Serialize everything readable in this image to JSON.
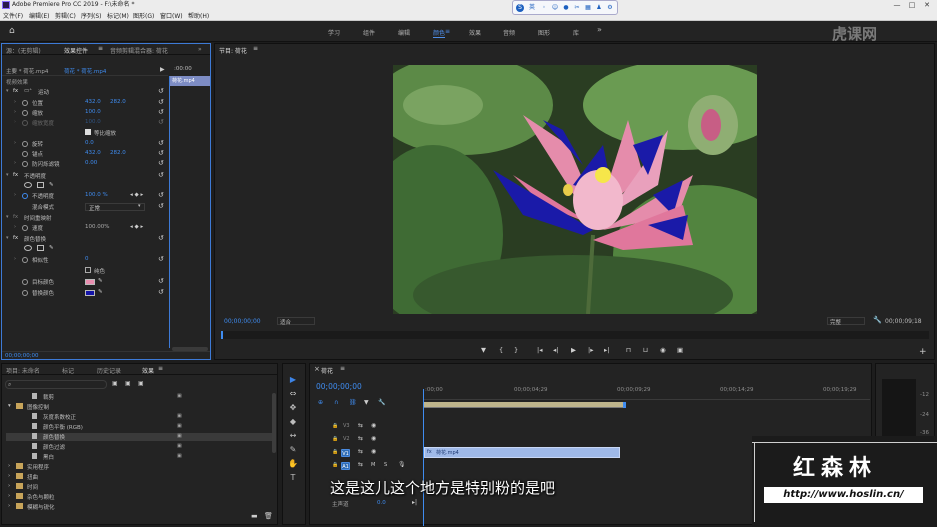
{
  "window": {
    "title": "Adobe Premiere Pro CC 2019 - F:\\未命名 *",
    "controls": [
      "—",
      "□",
      "✕"
    ]
  },
  "menu": [
    "文件(F)",
    "编辑(E)",
    "剪辑(C)",
    "序列(S)",
    "标记(M)",
    "图形(G)",
    "窗口(W)",
    "帮助(H)"
  ],
  "floatbar": {
    "label": "英"
  },
  "workspaces": {
    "items": [
      "学习",
      "组件",
      "编辑",
      "颜色",
      "效果",
      "音频",
      "图形",
      "库"
    ],
    "active": "颜色",
    "more": "»"
  },
  "watermark_top": "虎课网",
  "effect_controls": {
    "tabs": [
      "源：(无剪辑)",
      "效果控件",
      "音频剪辑混合器: 荷花"
    ],
    "path_master": "主要 * 荷花.mp4",
    "path_seq": "荷花 * 荷花.mp4",
    "timecode_start": ":00:00",
    "clip_name": "荷花.mp4",
    "section_video": "视频效果",
    "motion": "运动",
    "position": {
      "label": "位置",
      "x": "432.0",
      "y": "282.0"
    },
    "scale": {
      "label": "缩放",
      "value": "100.0"
    },
    "scale_width": {
      "label": "缩放宽度",
      "value": "100.0"
    },
    "uniform_scale": "等比缩放",
    "rotation": {
      "label": "旋转",
      "value": "0.0"
    },
    "anchor": {
      "label": "锚点",
      "x": "432.0",
      "y": "282.0"
    },
    "antiflicker": {
      "label": "防闪烁滤镜",
      "value": "0.00"
    },
    "opacity_section": "不透明度",
    "opacity": {
      "label": "不透明度",
      "value": "100.0 %"
    },
    "blend": {
      "label": "混合模式",
      "value": "正常"
    },
    "time_remap": "时间重映射",
    "speed": {
      "label": "速度",
      "value": "100.00%"
    },
    "color_replace": "颜色替换",
    "similarity": {
      "label": "相似性",
      "value": "0"
    },
    "solid": "纯色",
    "target_color": {
      "label": "目标颜色",
      "color": "#e98fb0"
    },
    "replace_color": {
      "label": "替换颜色",
      "color": "#1414a8"
    },
    "timecode": "00;00;00;00"
  },
  "program": {
    "title": "节目: 荷花",
    "timecode": "00;00;00;00",
    "fit": "适合",
    "quality": "完整",
    "duration": "00;00;09;18",
    "progress": 0.0
  },
  "subtitle": "这是这儿这个地方是特别粉的是吧",
  "brand": {
    "name": "红森林",
    "url": "http://www.hoslin.cn/"
  },
  "project": {
    "tabs": [
      "项目: 未命名",
      "标记",
      "历史记录",
      "效果"
    ],
    "active_tab": "效果",
    "items": [
      {
        "name": "裁剪",
        "indent": 1,
        "type": "bin"
      },
      {
        "name": "图像控制",
        "indent": 0,
        "type": "folder",
        "open": true
      },
      {
        "name": "灰度系数校正",
        "indent": 1,
        "type": "bin"
      },
      {
        "name": "颜色平衡 (RGB)",
        "indent": 1,
        "type": "bin"
      },
      {
        "name": "颜色替换",
        "indent": 1,
        "type": "bin",
        "selected": true
      },
      {
        "name": "颜色过滤",
        "indent": 1,
        "type": "bin"
      },
      {
        "name": "黑白",
        "indent": 1,
        "type": "bin"
      },
      {
        "name": "实用程序",
        "indent": 0,
        "type": "folder"
      },
      {
        "name": "扭曲",
        "indent": 0,
        "type": "folder"
      },
      {
        "name": "时间",
        "indent": 0,
        "type": "folder"
      },
      {
        "name": "杂色与颗粒",
        "indent": 0,
        "type": "folder"
      },
      {
        "name": "模糊与锐化",
        "indent": 0,
        "type": "folder"
      }
    ]
  },
  "tools": [
    "▶",
    "⇔",
    "✥",
    "◆",
    "↔",
    "✎",
    "✋",
    "T"
  ],
  "timeline": {
    "title": "荷花",
    "timecode": "00;00;00;00",
    "ruler": [
      ":00;00",
      "00;00;04;29",
      "00;00;09;29",
      "00;00;14;29",
      "00;00;19;29"
    ],
    "tracks": [
      {
        "id": "V3",
        "type": "video"
      },
      {
        "id": "V2",
        "type": "video"
      },
      {
        "id": "V1",
        "type": "video",
        "active": true
      },
      {
        "id": "A1",
        "type": "audio",
        "active": true
      }
    ],
    "master": {
      "label": "主声道",
      "value": "0.0"
    },
    "clip": {
      "name": "荷花.mp4",
      "track": "V1"
    },
    "meter_labels": [
      "-12",
      "-24",
      "-36"
    ]
  }
}
